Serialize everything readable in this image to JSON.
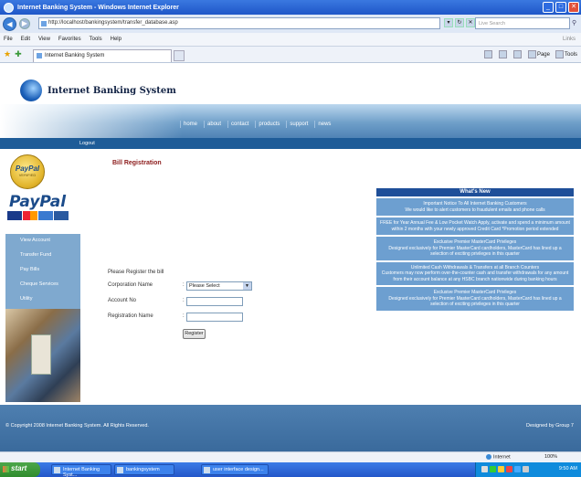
{
  "window": {
    "title": "Internet Banking System - Windows Internet Explorer",
    "controls": [
      "_",
      "□",
      "✕"
    ]
  },
  "address_bar": {
    "url": "http://localhost/bankingsystem/transfer_database.asp",
    "search_placeholder": "Live Search"
  },
  "menu": {
    "items": [
      "File",
      "Edit",
      "View",
      "Favorites",
      "Tools",
      "Help"
    ],
    "links": "Links"
  },
  "tab": {
    "label": "Internet Banking System"
  },
  "command_bar": {
    "page": "Page",
    "tools": "Tools"
  },
  "site": {
    "name": "Internet Banking System",
    "nav": [
      "home",
      "about",
      "contact",
      "products",
      "support",
      "news"
    ],
    "logout": "Logout"
  },
  "sidebar": {
    "badge_title": "PayPal",
    "badge_sub": "VERIFIED",
    "paypal_logo": "PayPal",
    "menu": [
      "View Account",
      "Transfer Fund",
      "Pay Bills",
      "Cheque Services",
      "Utility"
    ]
  },
  "form": {
    "title": "Bill Registration",
    "intro": "Please Register the bill",
    "colon": ":",
    "corporation_label": "Corporation Name",
    "corporation_value": "Please Select",
    "account_label": "Account No",
    "registration_label": "Registration Name",
    "submit": "Register"
  },
  "news": {
    "heading": "What's New",
    "items": [
      {
        "title": "Important Notice To All Internet Banking Customers",
        "body": "We would like to alert customers to fraudulent emails and phone calls"
      },
      {
        "title": "",
        "body": "FREE for Year Annual Fee & Low Pocket Watch Apply, activate and spend a minimum amount within 2 months with your newly approved Credit Card *Promotion period extended"
      },
      {
        "title": "Exclusive Premier MasterCard Privileges",
        "body": "Designed exclusively for Premier MasterCard cardholders, MasterCard has lined up a selection of exciting privileges in this quarter"
      },
      {
        "title": "Unlimited Cash Withdrawals & Transfers at all Branch Counters",
        "body": "Customers may now perform over-the-counter cash and transfer withdrawals for any amount from their account balance at any HSBC branch nationwide during banking hours"
      },
      {
        "title": "Exclusive Premier MasterCard Privileges",
        "body": "Designed exclusively for Premier MasterCard cardholders, MasterCard has lined up a selection of exciting privileges in this quarter"
      }
    ]
  },
  "footer": {
    "copyright": "© Copyright 2008 Internet Banking System. All Rights Reserved.",
    "designed": "Designed by Group 7"
  },
  "status": {
    "zone": "Internet",
    "zoom": "100%"
  },
  "taskbar": {
    "start": "start",
    "tasks": [
      "Internet Banking Syst...",
      "bankingsystem",
      "user interface design..."
    ],
    "clock": "9:50 AM"
  },
  "colors": {
    "title_blue": "#1f57c8",
    "nav_band": "#6f9fc9",
    "logout_bar": "#1e5c98",
    "news_head": "#1f4f99",
    "news_item": "#6d9fd0",
    "form_title": "#8b1a1a"
  }
}
